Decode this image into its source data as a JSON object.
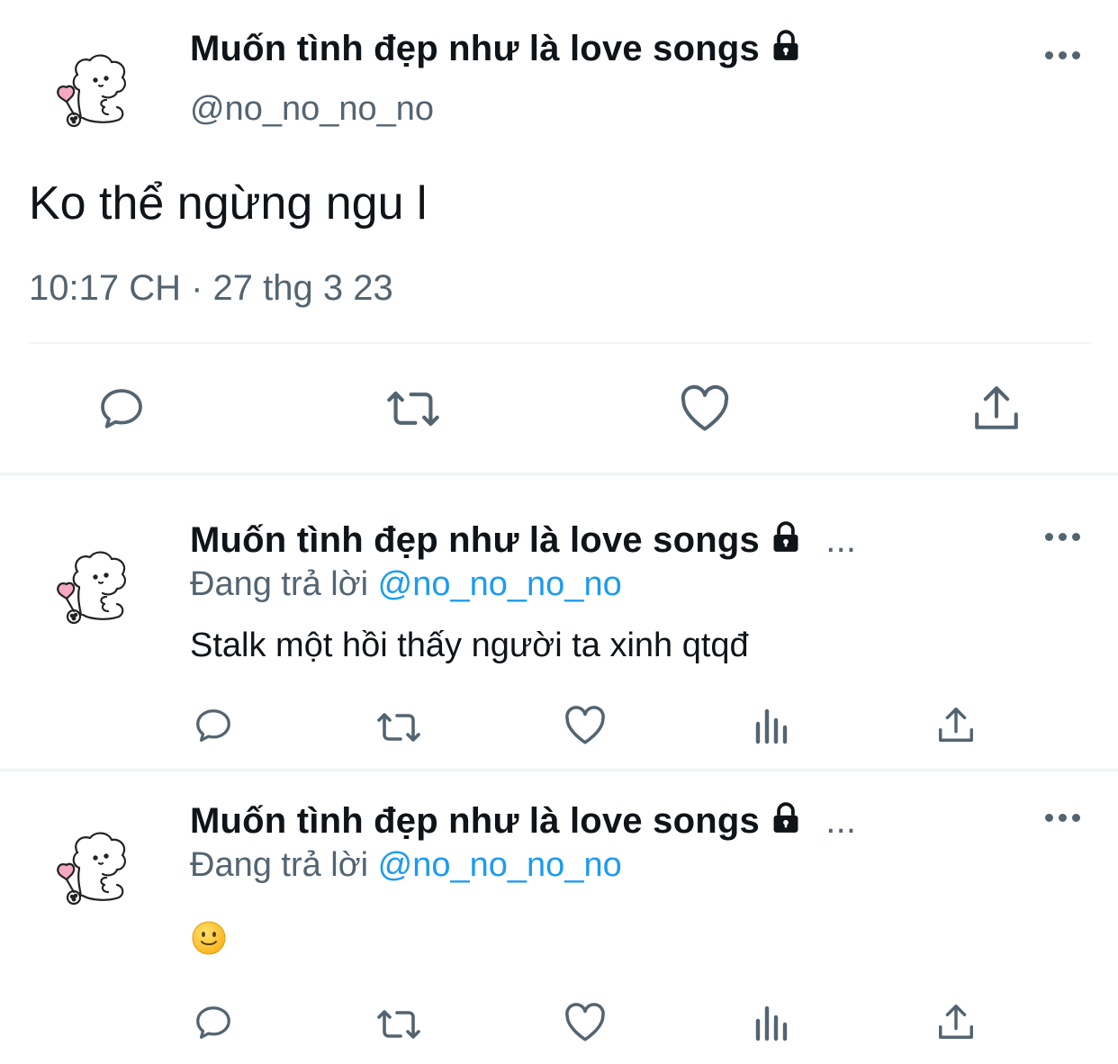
{
  "main_tweet": {
    "display_name": "Muốn tình đẹp như là love songs",
    "handle": "@no_no_no_no",
    "text": "Ko thể ngừng ngu l",
    "timestamp": "10:17 CH · 27 thg 3 23"
  },
  "replies": [
    {
      "display_name": "Muốn tình đẹp như là love songs",
      "ellipsis": "...",
      "replying_prefix": "Đang trả lời",
      "replying_to": "@no_no_no_no",
      "text": "Stalk một hồi thấy người ta xinh qtqđ"
    },
    {
      "display_name": "Muốn tình đẹp như là love songs",
      "ellipsis": "...",
      "replying_prefix": "Đang trả lời",
      "replying_to": "@no_no_no_no",
      "text": "🙂"
    }
  ],
  "icons": {
    "main_actions": [
      "reply-icon",
      "retweet-icon",
      "like-icon",
      "share-icon"
    ],
    "reply_actions": [
      "reply-icon",
      "retweet-icon",
      "like-icon",
      "analytics-icon",
      "share-icon"
    ],
    "badge": "lock-icon",
    "menu": "more-icon"
  },
  "colors": {
    "text": "#0f1419",
    "muted": "#536471",
    "link": "#1d9bf0",
    "divider": "#eff3f4"
  }
}
